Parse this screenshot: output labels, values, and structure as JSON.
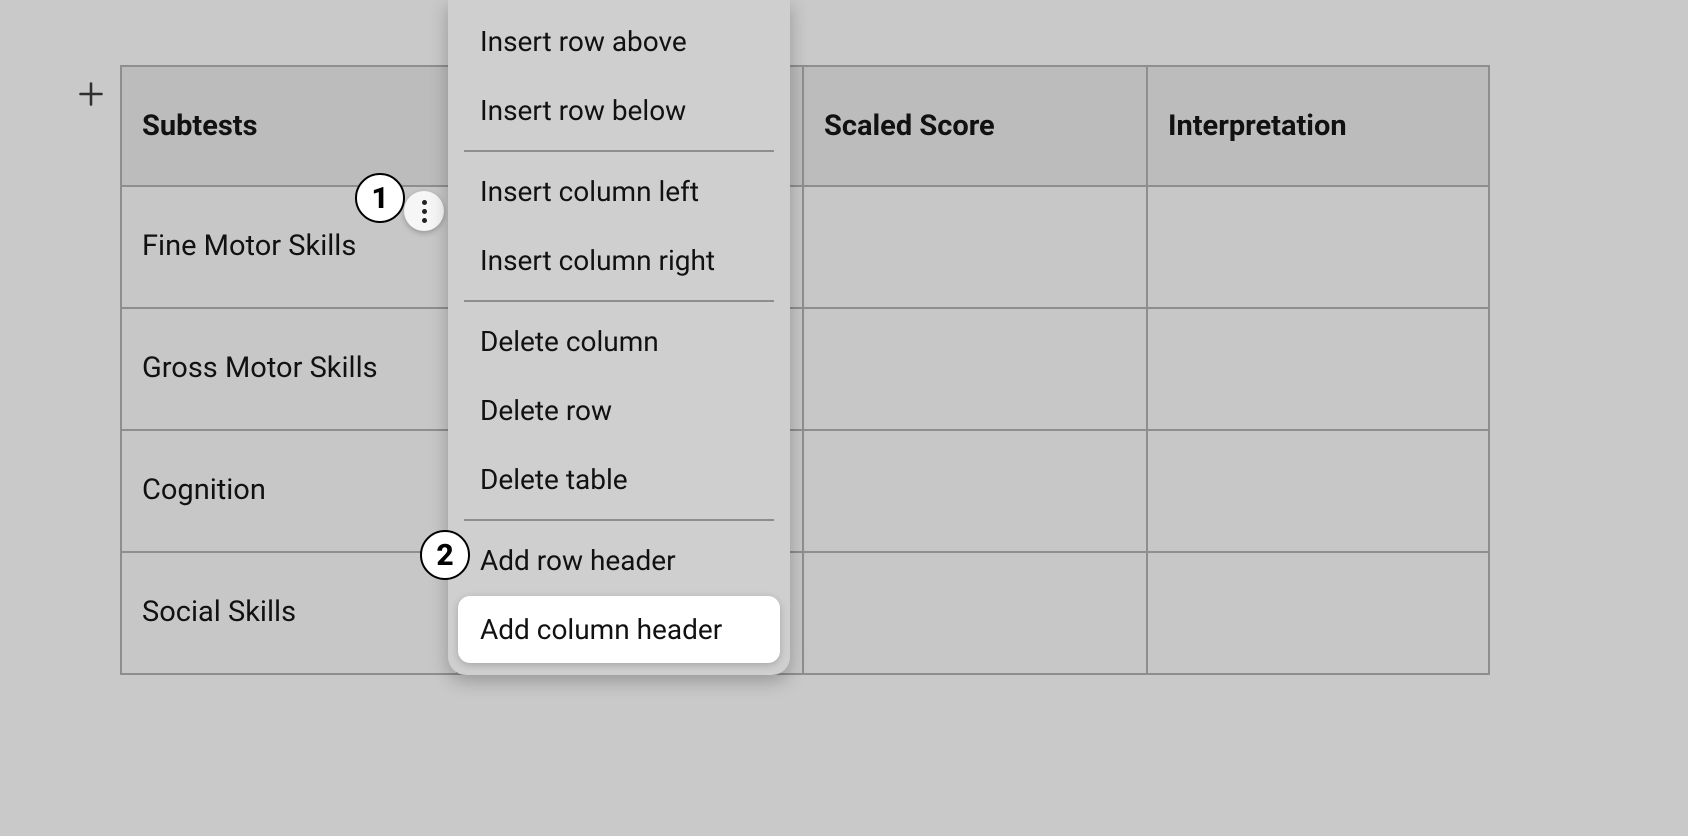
{
  "table": {
    "headers": [
      "Subtests",
      "",
      "Scaled Score",
      "Interpretation"
    ],
    "rows": [
      [
        "Fine Motor Skills",
        "",
        "",
        ""
      ],
      [
        "Gross Motor Skills",
        "",
        "",
        ""
      ],
      [
        "Cognition",
        "",
        "",
        ""
      ],
      [
        "Social Skills",
        "",
        "",
        ""
      ]
    ]
  },
  "context_menu": {
    "groups": [
      [
        "Insert row above",
        "Insert row below"
      ],
      [
        "Insert column left",
        "Insert column right"
      ],
      [
        "Delete column",
        "Delete row",
        "Delete table"
      ],
      [
        "Add row header",
        "Add column header"
      ]
    ],
    "highlighted": "Add column header"
  },
  "callouts": {
    "badge_1": "1",
    "badge_2": "2"
  }
}
